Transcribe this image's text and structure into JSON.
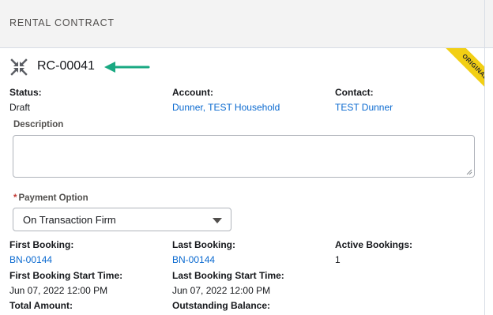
{
  "header": {
    "title": "RENTAL CONTRACT"
  },
  "ribbon": {
    "label": "ORIGINAL",
    "color": "#f2cf14"
  },
  "record": {
    "icon": "collapse-arrows-icon",
    "name": "RC-00041",
    "annotation": "arrow-pointer-icon",
    "annotation_color": "#1aa982"
  },
  "fields": {
    "status": {
      "label": "Status:",
      "value": "Draft"
    },
    "account": {
      "label": "Account:",
      "value": "Dunner, TEST Household"
    },
    "contact": {
      "label": "Contact:",
      "value": "TEST Dunner"
    }
  },
  "description": {
    "label": "Description",
    "value": ""
  },
  "payment": {
    "required_mark": "*",
    "label": "Payment Option",
    "selected": "On Transaction Firm"
  },
  "bookings": {
    "first_booking": {
      "label": "First Booking:",
      "value": "BN-00144"
    },
    "last_booking": {
      "label": "Last Booking:",
      "value": "BN-00144"
    },
    "active_bookings": {
      "label": "Active Bookings:",
      "value": "1"
    },
    "first_start": {
      "label": "First Booking Start Time:",
      "value": "Jun 07, 2022 12:00 PM"
    },
    "last_start": {
      "label": "Last Booking Start Time:",
      "value": "Jun 07, 2022 12:00 PM"
    },
    "total_amount": {
      "label": "Total Amount:"
    },
    "outstanding_balance": {
      "label": "Outstanding Balance:"
    }
  },
  "colors": {
    "link": "#0b6ad0",
    "required": "#c23934",
    "header_bg": "#f3f3f3"
  }
}
